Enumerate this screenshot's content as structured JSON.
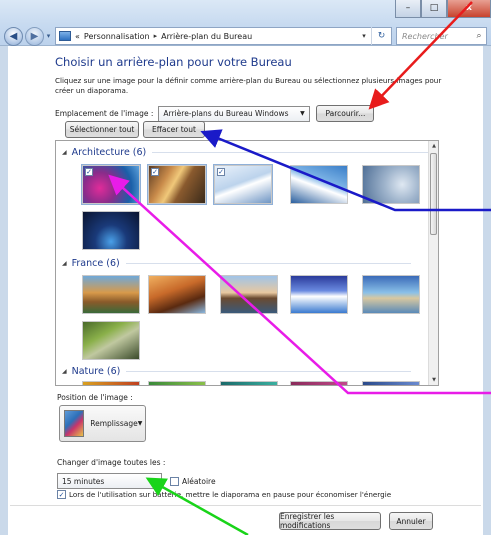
{
  "window": {
    "minimize_glyph": "–",
    "maximize_glyph": "□",
    "close_glyph": "x"
  },
  "nav": {
    "back_glyph": "◀",
    "forward_glyph": "▶",
    "breadcrumb_prefix": "«",
    "breadcrumb": [
      "Personnalisation",
      "Arrière-plan du Bureau"
    ],
    "breadcrumb_sep": "▸",
    "search_placeholder": "Rechercher"
  },
  "page": {
    "title": "Choisir un arrière-plan pour votre Bureau",
    "description": "Cliquez sur une image pour la définir comme arrière-plan du Bureau ou sélectionnez plusieurs images pour créer un diaporama."
  },
  "location": {
    "label": "Emplacement de l'image :",
    "value": "Arrière-plans du Bureau Windows",
    "browse_label": "Parcourir..."
  },
  "actions": {
    "select_all": "Sélectionner tout",
    "clear_all": "Effacer tout"
  },
  "gallery": {
    "groups": [
      {
        "name": "Architecture (6)",
        "checked": [
          true,
          true,
          true,
          false,
          false,
          false
        ]
      },
      {
        "name": "France (6)",
        "checked": [
          false,
          false,
          false,
          false,
          false,
          false
        ]
      },
      {
        "name": "Nature (6)",
        "checked": [
          false,
          false,
          false,
          false,
          false,
          false
        ]
      }
    ]
  },
  "position": {
    "label": "Position de l'image :",
    "value": "Remplissage"
  },
  "slideshow": {
    "change_label": "Changer d'image toutes les :",
    "interval": "15 minutes",
    "shuffle_label": "Aléatoire",
    "shuffle_checked": false,
    "battery_label": "Lors de l'utilisation sur batterie, mettre le diaporama en pause pour économiser l'énergie",
    "battery_checked": true
  },
  "footer": {
    "save_label": "Enregistrer les modifications",
    "cancel_label": "Annuler"
  },
  "annotation_colors": {
    "red": "#e81c1c",
    "blue": "#1a1ac8",
    "magenta": "#e81ce8",
    "green": "#19d419"
  }
}
